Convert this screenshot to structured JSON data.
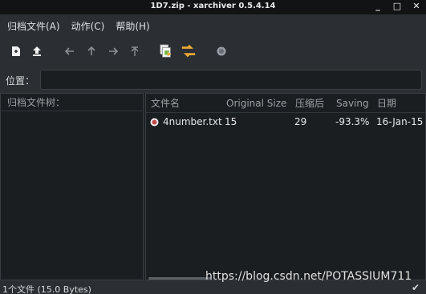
{
  "window": {
    "title": "1D7.zip - xarchiver 0.5.4.14"
  },
  "window_controls": {
    "minimize": "_",
    "maximize": "□",
    "close": "✕"
  },
  "menu": [
    "归档文件(A)",
    "动作(C)",
    "帮助(H)"
  ],
  "toolbar_icons": [
    "new-archive-icon",
    "open-archive-icon",
    "back-icon",
    "up-icon",
    "forward-icon",
    "root-icon",
    "extract-icon",
    "convert-icon",
    "stop-icon"
  ],
  "location": {
    "label": "位置：",
    "value": ""
  },
  "tree": {
    "header": "归档文件树："
  },
  "columns": [
    "文件名",
    "Original Size",
    "压缩后",
    "Saving",
    "日期"
  ],
  "files": [
    {
      "name": "4number.txt",
      "original_size": "15",
      "compressed": "29",
      "saving": "-93.3%",
      "date": "16-Jan-15"
    }
  ],
  "status": {
    "text": "1个文件 (15.0 Bytes)",
    "icon": "checkmark-icon"
  },
  "watermark": "https://blog.csdn.net/POTASSIUM711",
  "colors": {
    "background": "#1e2124",
    "panel": "#2b2f33",
    "title_bar": "#111315",
    "text": "#d6d8da",
    "file_icon": "#c24a4a"
  }
}
